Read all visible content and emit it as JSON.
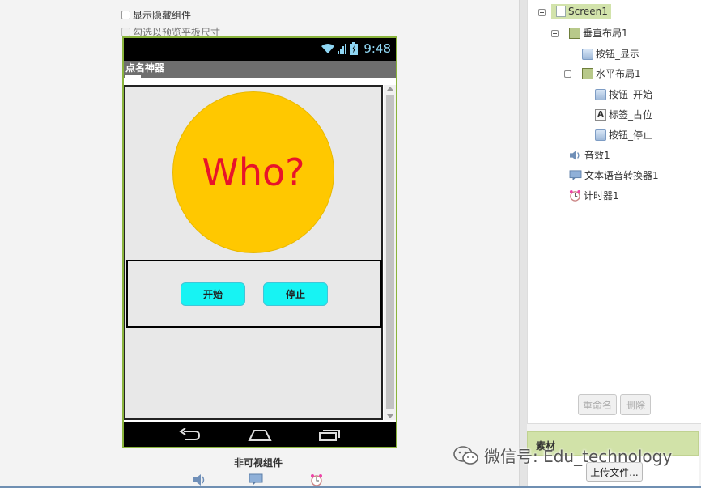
{
  "options": {
    "show_hidden": "显示隐藏组件",
    "tablet_preview": "勾选以预览平板尺寸"
  },
  "phone": {
    "time": "9:48",
    "app_title": "点名神器",
    "circle_text": "Who?",
    "start_button": "开始",
    "stop_button": "停止"
  },
  "nonvisible": {
    "label": "非可视组件",
    "icons": [
      "speaker-icon",
      "speech-bubble-icon",
      "alarm-clock-icon"
    ]
  },
  "tree": {
    "screen": "Screen1",
    "vertical_layout": "垂直布局1",
    "button_show": "按钮_显示",
    "horizontal_layout": "水平布局1",
    "button_start": "按钮_开始",
    "label_placeholder": "标签_占位",
    "button_stop": "按钮_停止",
    "sound": "音效1",
    "tts": "文本语音转换器1",
    "timer": "计时器1",
    "label_icon_letter": "A"
  },
  "actions": {
    "rename": "重命名",
    "delete": "删除"
  },
  "media": {
    "title": "素材",
    "upload": "上传文件..."
  },
  "watermark": {
    "text": "微信号: Edu_technology"
  },
  "colors": {
    "accent_green": "#8ab43c",
    "circle_yellow": "#ffc800",
    "who_red": "#e8132a",
    "button_cyan": "#17f3f3",
    "tree_highlight": "#d2e3ab"
  }
}
